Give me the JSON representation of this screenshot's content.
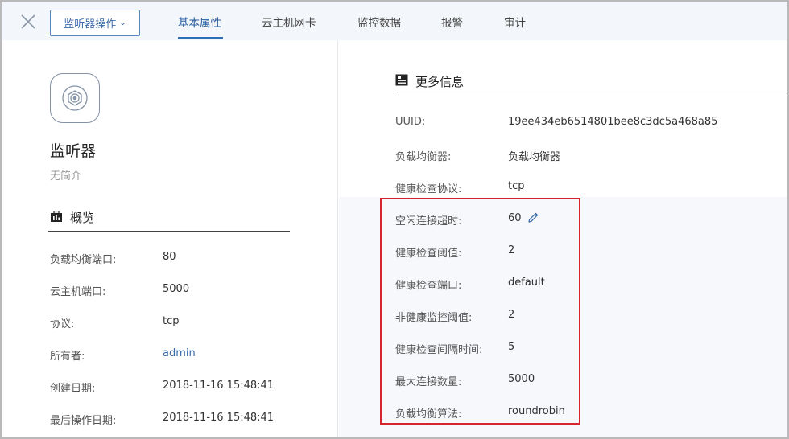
{
  "tabs": {
    "ops_button": "监听器操作",
    "items": [
      "基本属性",
      "云主机网卡",
      "监控数据",
      "报警",
      "审计"
    ]
  },
  "entity": {
    "name": "监听器",
    "description": "无简介"
  },
  "overview": {
    "title": "概览",
    "rows": [
      {
        "label": "负载均衡端口:",
        "value": "80"
      },
      {
        "label": "云主机端口:",
        "value": "5000"
      },
      {
        "label": "协议:",
        "value": "tcp"
      },
      {
        "label": "所有者:",
        "value": "admin"
      },
      {
        "label": "创建日期:",
        "value": "2018-11-16 15:48:41"
      },
      {
        "label": "最后操作日期:",
        "value": "2018-11-16 15:48:41"
      }
    ]
  },
  "more_info": {
    "title": "更多信息",
    "rows": [
      {
        "label": "UUID:",
        "value": "19ee434eb6514801bee8c3dc5a468a85"
      },
      {
        "label": "负载均衡器:",
        "value": "负载均衡器"
      },
      {
        "label": "健康检查协议:",
        "value": "tcp"
      },
      {
        "label": "空闲连接超时:",
        "value": "60"
      },
      {
        "label": "健康检查阈值:",
        "value": "2"
      },
      {
        "label": "健康检查端口:",
        "value": "default"
      },
      {
        "label": "非健康监控阈值:",
        "value": "2"
      },
      {
        "label": "健康检查间隔时间:",
        "value": "5"
      },
      {
        "label": "最大连接数量:",
        "value": "5000"
      },
      {
        "label": "负载均衡算法:",
        "value": "roundrobin"
      }
    ]
  },
  "colors": {
    "accent": "#2f6fb8",
    "link": "#3b6aa8",
    "highlight": "#d6252c"
  }
}
